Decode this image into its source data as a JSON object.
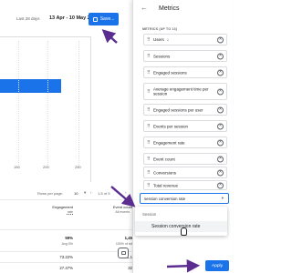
{
  "report": {
    "date_label": "Last 28 days",
    "date_range": "13 Apr - 10 May 2023",
    "save_label": "Save...",
    "axis_ticks": [
      "150",
      "200",
      "250"
    ],
    "rows_per_page_label": "Rows per page:",
    "rows_per_page_value": "10",
    "range_text": "1-5 of 5",
    "columns": [
      {
        "head": "Engagement",
        "sub": "rate"
      },
      {
        "head": "Event count",
        "sub": "All events"
      }
    ],
    "totals": [
      "59%",
      "1,45"
    ],
    "totals_sub": [
      "Avg 0%",
      "100% of tot"
    ],
    "row1": [
      "73.22%",
      "1,1"
    ],
    "row2": [
      "27.47%",
      "32"
    ]
  },
  "panel": {
    "title": "Metrics",
    "section_label": "METRICS (UP TO 13)",
    "metrics": [
      "Users",
      "Sessions",
      "Engaged sessions",
      "Average engagement time per session",
      "Engaged sessions per user",
      "Events per session",
      "Engagement rate",
      "Event count",
      "Conversions",
      "Total revenue"
    ],
    "search_value": "session conversion rate",
    "dropdown_group": "Session",
    "dropdown_option": "Session conversion rate",
    "apply_label": "Apply"
  },
  "colors": {
    "accent": "#1a73e8",
    "annotation_arrow": "#5b2d91"
  },
  "icons": [
    "back-arrow-icon",
    "drag-handle-icon",
    "remove-circle-icon",
    "save-icon",
    "chat-icon",
    "dropdown-caret-icon",
    "sort-down-icon"
  ]
}
